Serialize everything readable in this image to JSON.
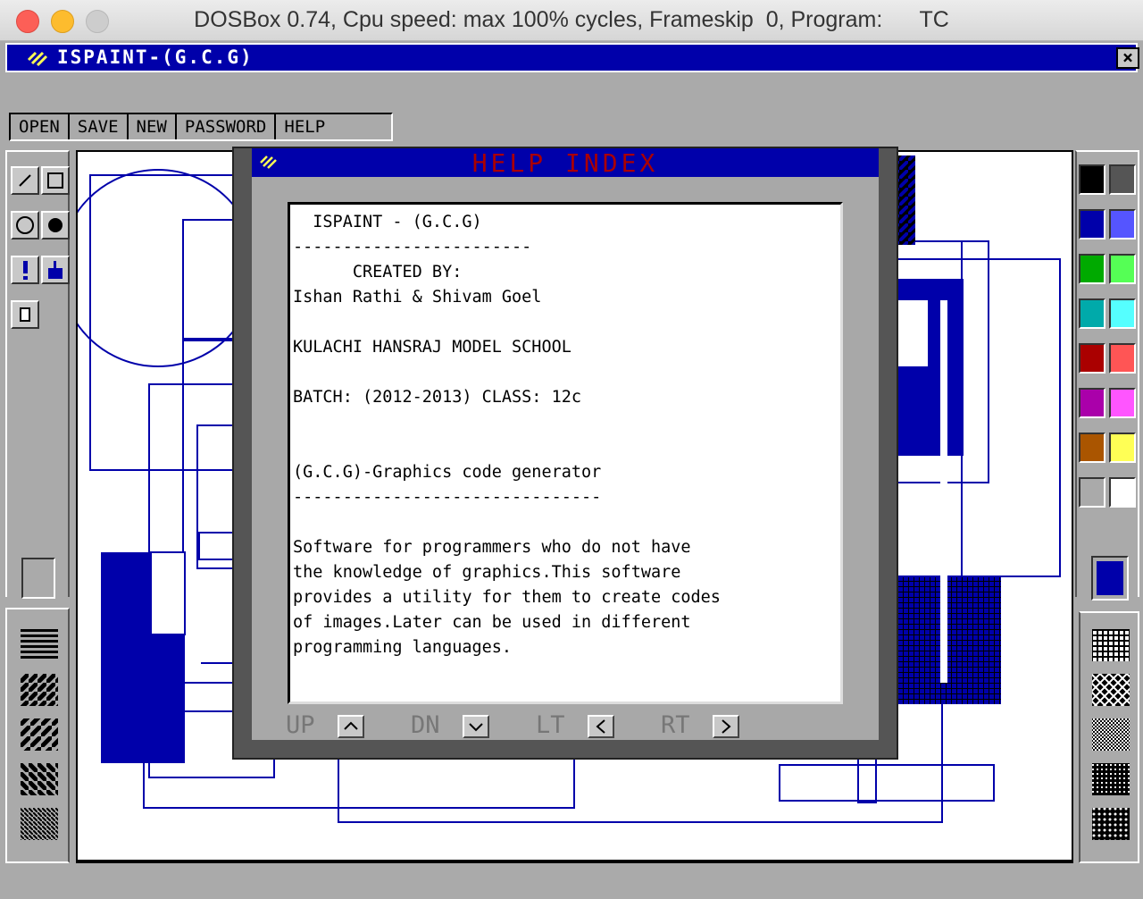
{
  "window": {
    "title": "DOSBox 0.74, Cpu speed: max 100% cycles, Frameskip  0, Program:      TC",
    "close_color": "#fc5f57",
    "minimize_color": "#fdbc2e",
    "zoom_color": "#cdcdcd"
  },
  "app": {
    "title": "ISPAINT-(G.C.G)",
    "close_label": "×"
  },
  "menu": [
    {
      "label": "OPEN"
    },
    {
      "label": "SAVE"
    },
    {
      "label": "NEW"
    },
    {
      "label": "PASSWORD"
    },
    {
      "label": "HELP"
    }
  ],
  "tools": [
    {
      "icon": "line-tool-icon"
    },
    {
      "icon": "rectangle-tool-icon"
    },
    {
      "icon": "circle-tool-icon"
    },
    {
      "icon": "filled-circle-tool-icon"
    },
    {
      "icon": "spray-tool-icon"
    },
    {
      "icon": "fill-tool-icon"
    },
    {
      "icon": "eraser-tool-icon"
    }
  ],
  "palette": [
    "#000000",
    "#555555",
    "#0000aa",
    "#5555ff",
    "#00aa00",
    "#55ff55",
    "#00aaaa",
    "#55ffff",
    "#aa0000",
    "#ff5555",
    "#aa00aa",
    "#ff55ff",
    "#aa5500",
    "#ffff55",
    "#aaaaaa",
    "#ffffff"
  ],
  "current_color": "#0000aa",
  "help": {
    "title": "HELP INDEX",
    "lines": [
      "  ISPAINT - (G.C.G)",
      "------------------------",
      "      CREATED BY:",
      "Ishan Rathi & Shivam Goel",
      "",
      "KULACHI HANSRAJ MODEL SCHOOL",
      "",
      "BATCH: (2012-2013) CLASS: 12c",
      "",
      "",
      "(G.C.G)-Graphics code generator",
      "-------------------------------",
      "",
      "Software for programmers who do not have",
      "the knowledge of graphics.This software",
      "provides a utility for them to create codes",
      "of images.Later can be used in different",
      "programming languages."
    ],
    "nav": [
      {
        "label": "UP",
        "icon": "up-arrow-icon"
      },
      {
        "label": "DN",
        "icon": "down-arrow-icon"
      },
      {
        "label": "LT",
        "icon": "left-arrow-icon"
      },
      {
        "label": "RT",
        "icon": "right-arrow-icon"
      }
    ]
  }
}
